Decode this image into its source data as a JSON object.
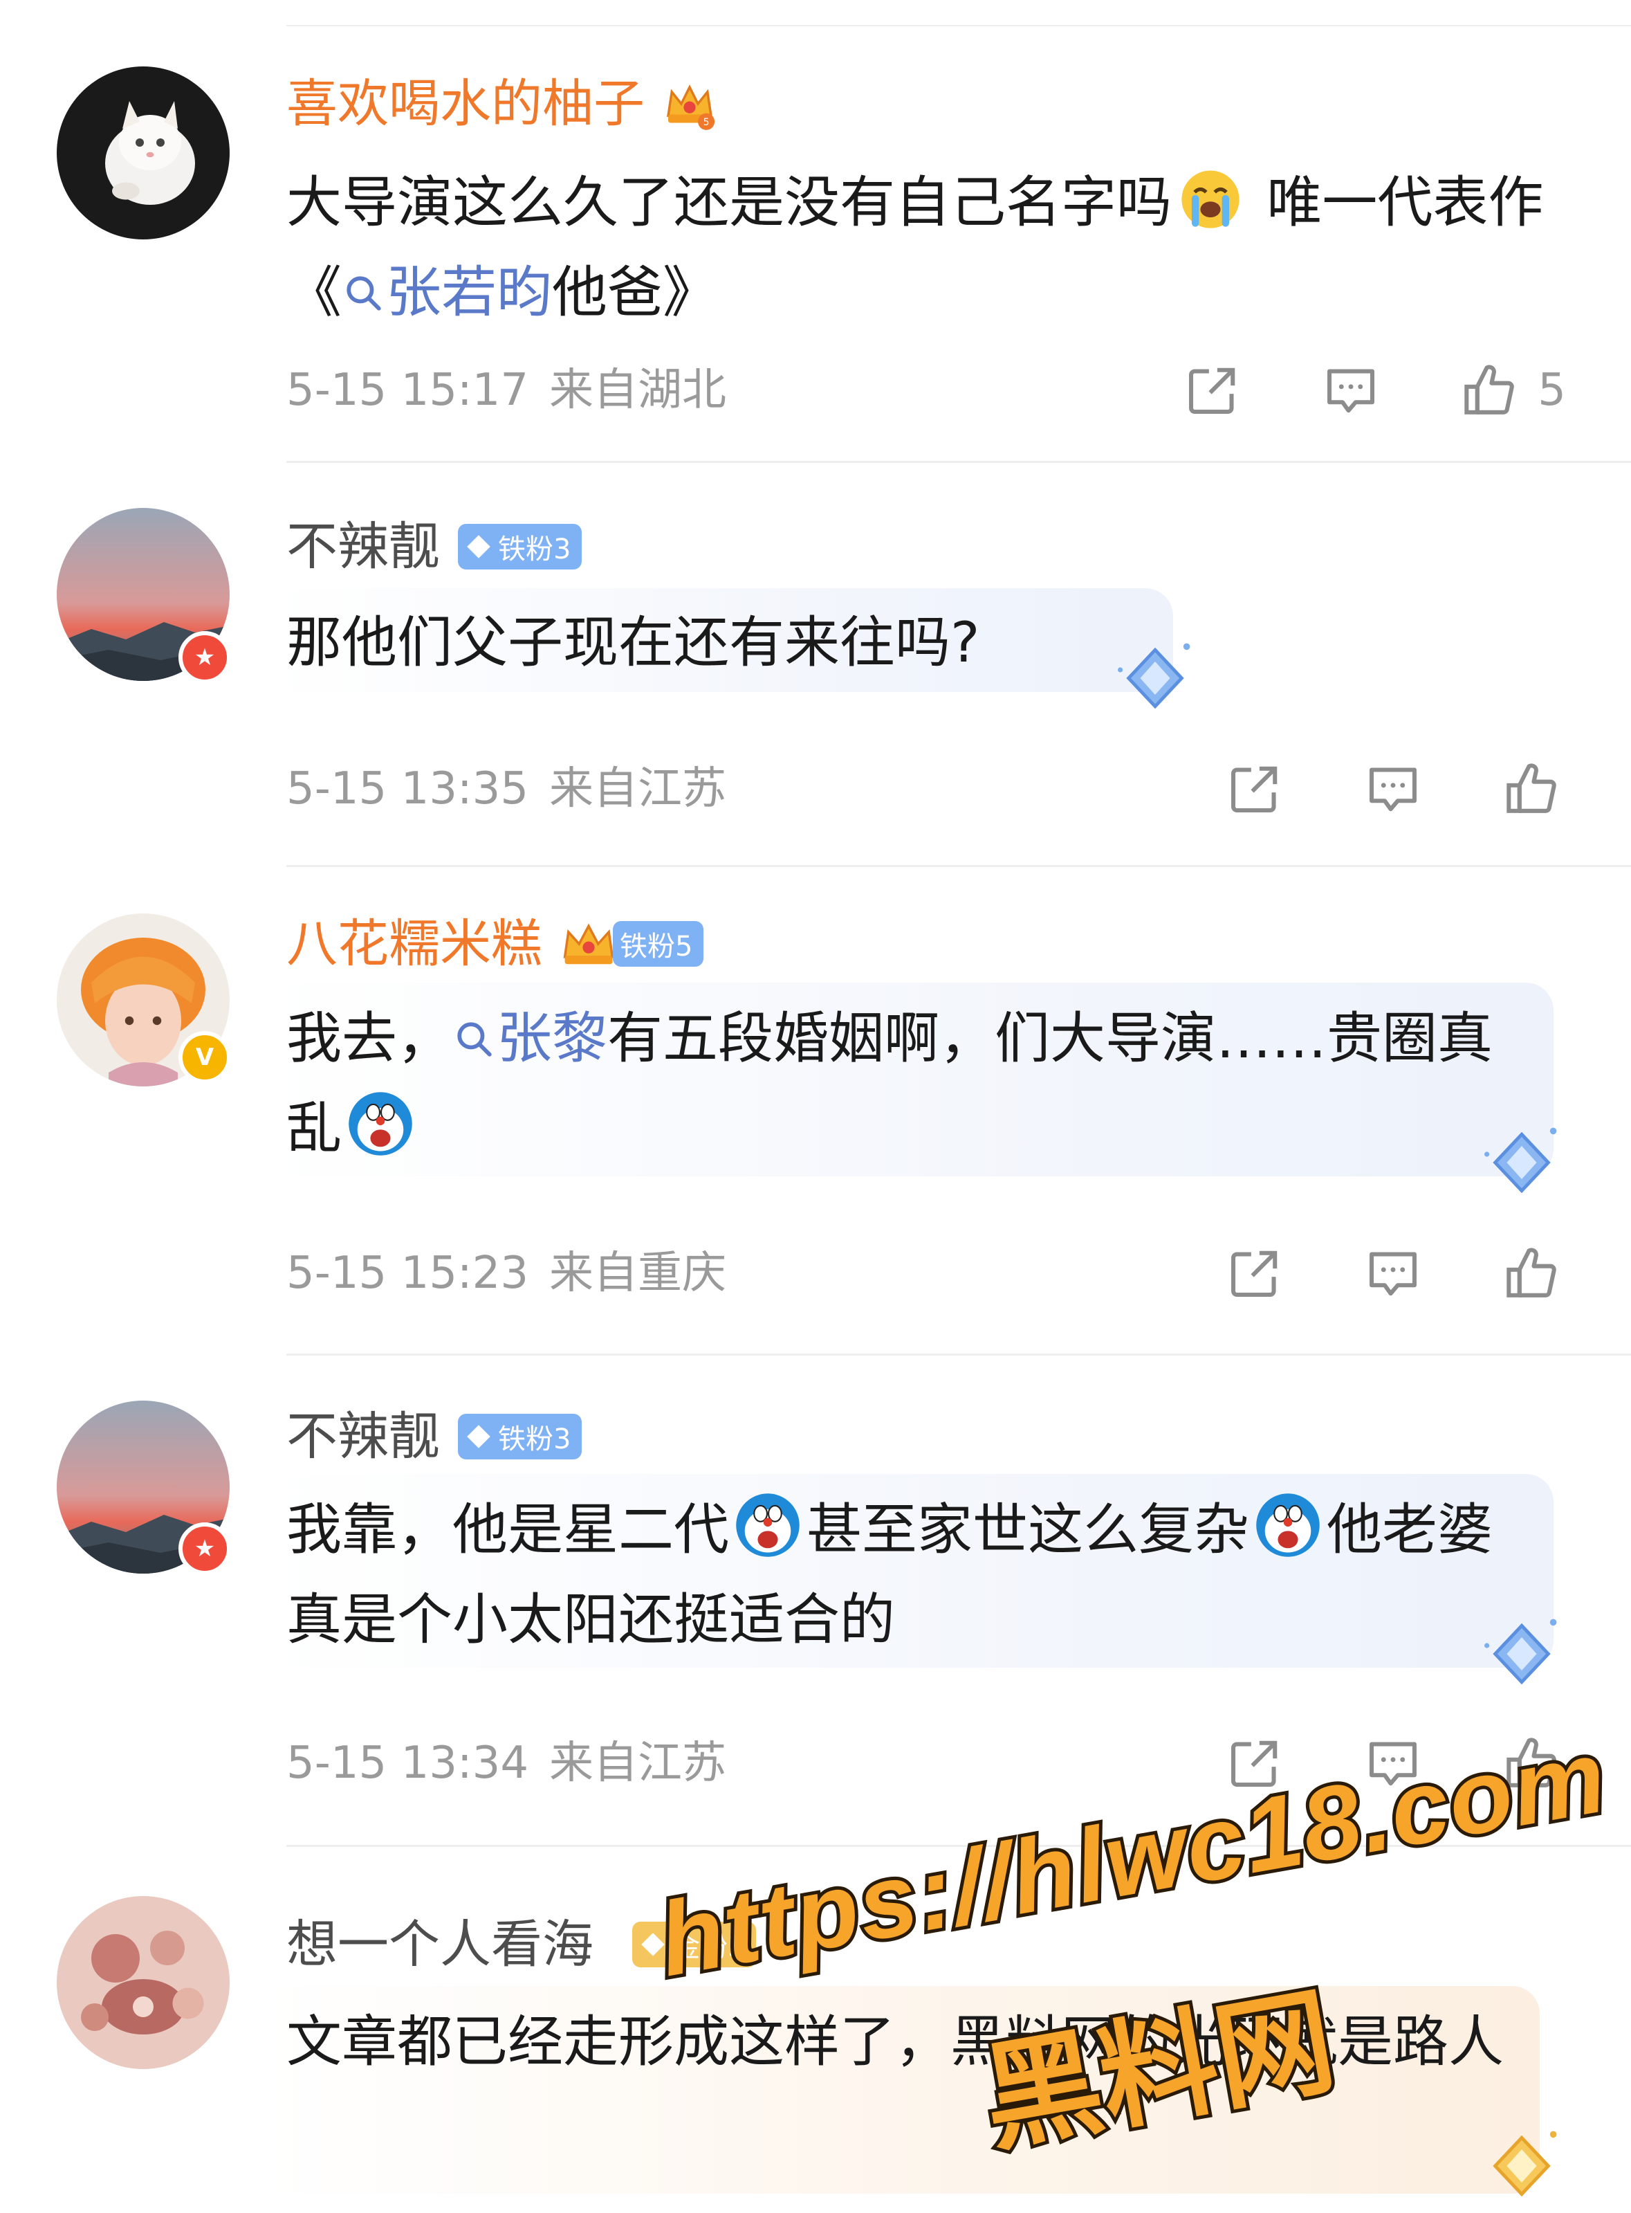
{
  "comments": [
    {
      "username": "喜欢喝水的柚子",
      "text_a": "大导演这么久了还是没有自己名字吗",
      "text_b": " 唯一代表作《",
      "topic": "张若昀",
      "text_c": "他爸》",
      "time": "5-15 15:17",
      "location": "来自湖北",
      "likes": "5",
      "crown_level": "5"
    },
    {
      "username": "不辣靓",
      "fan_badge": "铁粉3",
      "text": "那他们父子现在还有来往吗?",
      "time": "5-15 13:35",
      "location": "来自江苏"
    },
    {
      "username": "八花糯米糕",
      "fan_badge": "铁粉5",
      "text_a": "我去，",
      "topic": "张黎",
      "text_b": "有五段婚姻啊，们大导演……贵圈真乱",
      "time": "5-15 15:23",
      "location": "来自重庆",
      "verified": "V"
    },
    {
      "username": "不辣靓",
      "fan_badge": "铁粉3",
      "text_a": "我靠，他是星二代",
      "text_b": "甚至家世这么复杂",
      "text_c": "他老婆真是个小太阳还挺适合的",
      "time": "5-15 13:34",
      "location": "来自江苏"
    },
    {
      "username": "想一个人看海",
      "fan_badge": "金粉3",
      "text": "文章都已经走形成这样了，黑料网的光环就是路人"
    }
  ],
  "watermark": {
    "url": "https://hlwc18.com",
    "name": "黑料网"
  },
  "colors": {
    "topic_link": "#5a79c8",
    "orange_name": "#f0782a",
    "meta_gray": "#9a9a9a",
    "fan_blue": "#7fb2f5",
    "fan_gold": "#f4c65d"
  },
  "icons": [
    "share-icon",
    "comment-icon",
    "like-icon",
    "search-icon",
    "crying-emoji",
    "doraemon-emoji",
    "crown-icon",
    "diamond-icon"
  ]
}
